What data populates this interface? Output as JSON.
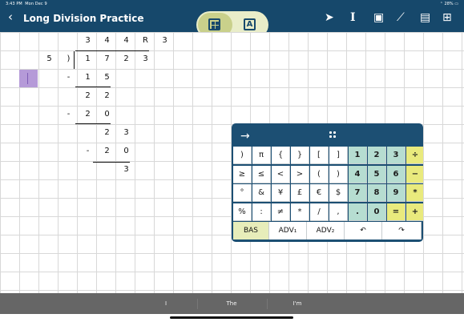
{
  "status": {
    "time": "3:43 PM",
    "date": "Mon Dec 9",
    "right": "28%"
  },
  "header": {
    "back_icon": "back-chevron-icon",
    "title": "Long Division Practice",
    "title_caret_icon": "chevron-down-icon",
    "segment_icons": [
      "grid-tool-icon",
      "text-tool-icon"
    ],
    "segment_text": "A"
  },
  "toolbar_icons": [
    "pointer-icon",
    "text-cursor-icon",
    "shape-icon",
    "connector-icon",
    "comment-icon",
    "add-page-icon"
  ],
  "worksheet": {
    "rows": [
      [
        "",
        "",
        "",
        "",
        "3",
        "4",
        "4",
        "R",
        "3"
      ],
      [
        "",
        "",
        "5",
        ")",
        "1",
        "7",
        "2",
        "3",
        ""
      ],
      [
        "",
        "",
        "",
        "-",
        "1",
        "5",
        "",
        "",
        ""
      ],
      [
        "",
        "",
        "",
        "",
        "2",
        "2",
        "",
        "",
        ""
      ],
      [
        "",
        "",
        "",
        "-",
        "2",
        "0",
        "",
        "",
        ""
      ],
      [
        "",
        "",
        "",
        "",
        "",
        "2",
        "3",
        "",
        ""
      ],
      [
        "",
        "",
        "",
        "",
        "-",
        "2",
        "0",
        "",
        ""
      ],
      [
        "",
        "",
        "",
        "",
        "",
        "",
        "3",
        "",
        ""
      ]
    ]
  },
  "keyboard": {
    "arrow_icon": "arrow-right-icon",
    "grip_icon": "drag-handle-icon",
    "rows": [
      [
        ")",
        "π",
        "{",
        "}",
        "[",
        "]",
        "1",
        "2",
        "3",
        "÷"
      ],
      [
        "≥",
        "≤",
        "<",
        ">",
        "(",
        ")",
        "4",
        "5",
        "6",
        "−"
      ],
      [
        "°",
        "&",
        "¥",
        "£",
        "€",
        "$",
        "7",
        "8",
        "9",
        "*"
      ],
      [
        "%",
        ":",
        "≠",
        "*",
        "/",
        ",",
        ".",
        "0",
        "=",
        "+"
      ]
    ],
    "bottom": [
      "BAS",
      "ADV₁",
      "ADV₂",
      "undo-icon",
      "redo-icon"
    ]
  },
  "suggestions": [
    "I",
    "The",
    "I'm"
  ]
}
